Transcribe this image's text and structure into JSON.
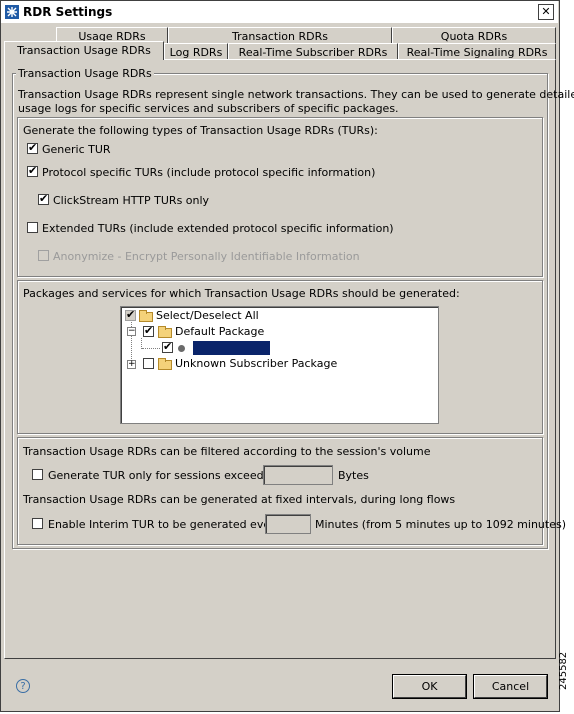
{
  "window": {
    "title": "RDR Settings",
    "close_glyph": "✕"
  },
  "tabs_row1": [
    "Usage RDRs",
    "Transaction RDRs",
    "Quota RDRs"
  ],
  "tabs_row2": [
    "Transaction Usage RDRs",
    "Log RDRs",
    "Real-Time Subscriber RDRs",
    "Real-Time Signaling RDRs"
  ],
  "active_tab": "Transaction Usage RDRs",
  "section": {
    "legend": "Transaction Usage RDRs",
    "description_line1": "Transaction Usage RDRs represent single network transactions. They can be used to generate detailed",
    "description_line2": "usage logs for specific services and subscribers of specific packages."
  },
  "tur_types": {
    "heading": "Generate the following types of Transaction Usage RDRs (TURs):",
    "generic": {
      "label": "Generic TUR",
      "checked": true
    },
    "protocol": {
      "label": "Protocol specific TURs (include protocol specific information)",
      "checked": true
    },
    "clickstream": {
      "label": "ClickStream HTTP TURs only",
      "checked": true
    },
    "extended": {
      "label": "Extended TURs (include extended protocol specific information)",
      "checked": false
    },
    "anonymize": {
      "label": "Anonymize - Encrypt Personally Identifiable Information",
      "checked": false,
      "disabled": true
    }
  },
  "packages": {
    "heading": "Packages and services for which Transaction Usage RDRs should be generated:",
    "tree": {
      "select_all": "Select/Deselect All",
      "default_package": "Default Package",
      "selected_service": "",
      "unknown_package": "Unknown Subscriber Package"
    }
  },
  "volume": {
    "heading": "Transaction Usage RDRs can be filtered according to the session's volume",
    "option_label": "Generate TUR only for sessions exceeding",
    "value": "",
    "unit": "Bytes"
  },
  "interval": {
    "heading": "Transaction Usage RDRs can be generated at fixed intervals, during long flows",
    "option_label": "Enable Interim TUR to be generated every",
    "value": "",
    "unit": "Minutes (from 5 minutes up to 1092 minutes)"
  },
  "buttons": {
    "ok": "OK",
    "cancel": "Cancel",
    "help": "?"
  },
  "figure_number": "245582"
}
